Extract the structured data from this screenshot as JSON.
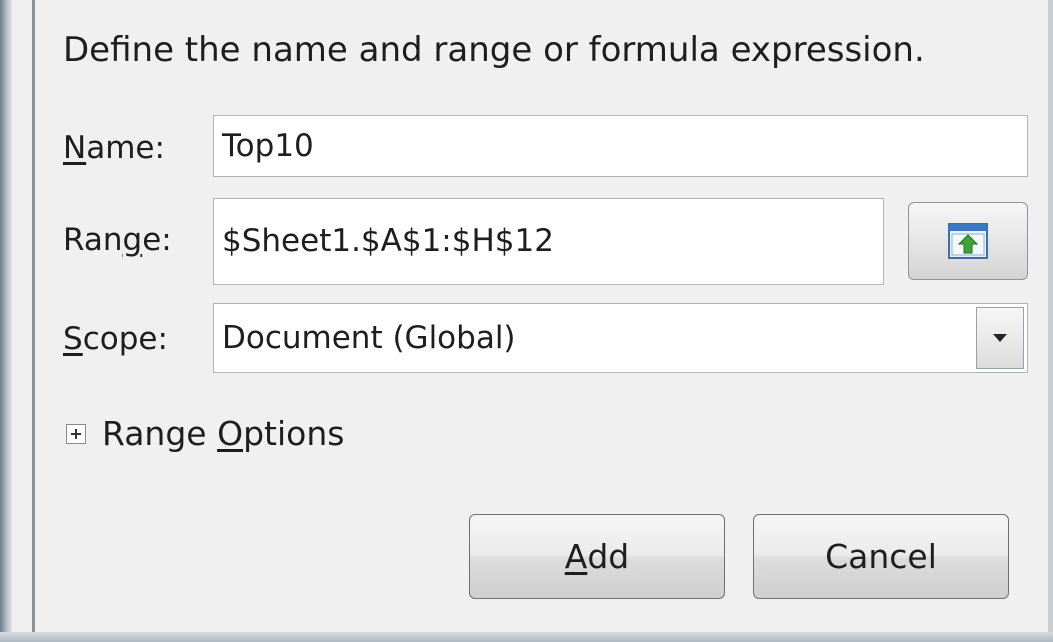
{
  "dialog": {
    "instruction": "Define the name and range or formula expression.",
    "name": {
      "label_access": "N",
      "label_rest": "ame:",
      "value": "Top10"
    },
    "range": {
      "label_pre": "Ran",
      "label_access": "g",
      "label_rest": "e:",
      "value": "$Sheet1.$A$1:$H$12",
      "shrink_icon": "shrink-to-sheet-icon"
    },
    "scope": {
      "label_access": "S",
      "label_rest": "cope:",
      "value": "Document (Global)",
      "dropdown_icon": "chevron-down-icon"
    },
    "range_options": {
      "label_pre": "Range ",
      "label_access": "O",
      "label_rest": "ptions",
      "state": "collapsed"
    },
    "buttons": {
      "add_access": "A",
      "add_rest": "dd",
      "cancel": "Cancel"
    }
  }
}
